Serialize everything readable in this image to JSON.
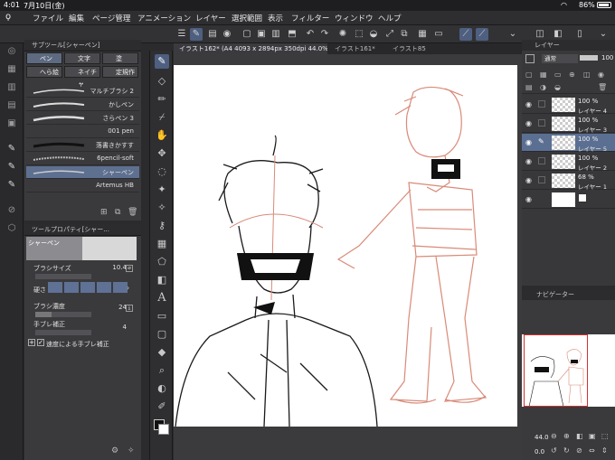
{
  "status_bar": {
    "time": "4:01",
    "date": "7月10日(金)",
    "battery": "86%"
  },
  "menu": [
    "ファイル",
    "編集",
    "ページ管理",
    "アニメーション",
    "レイヤー",
    "選択範囲",
    "表示",
    "フィルター",
    "ウィンドウ",
    "ヘルプ"
  ],
  "subtool_panel": {
    "title": "サブツール[シャーペン]",
    "tabs": [
      "ペン",
      "文字",
      "塗",
      "へら絵",
      "ネイチャ",
      "定規作"
    ],
    "brushes": [
      "マルチブラシ 2",
      "かしペン",
      "さらペン 3",
      "001 pen",
      "落書きかすす",
      "6pencil-soft",
      "シャーペン",
      "Artemus HB"
    ],
    "selected_brush": "シャーペン"
  },
  "tool_property": {
    "title": "ツールプロパティ[シャー...",
    "tool_name": "シャーペン",
    "brush_size_label": "ブラシサイズ",
    "brush_size_value": "10.4",
    "hardness_label": "硬さ",
    "density_label": "ブラシ濃度",
    "density_value": "24",
    "stabilization_label": "手ブレ補正",
    "stabilization_value": "4",
    "speed_stabilization_label": "速度による手ブレ補正"
  },
  "document_tabs": [
    "イラスト162* (A4 4093 x 2894px 350dpi 44.0%)",
    "イラスト161*",
    "イラスト85"
  ],
  "layer_panel": {
    "title": "レイヤー",
    "blend_mode": "通常",
    "opacity": "100",
    "layers": [
      {
        "opacity": "100 %",
        "name": "レイヤー 4",
        "selected": false
      },
      {
        "opacity": "100 %",
        "name": "レイヤー 3",
        "selected": false
      },
      {
        "opacity": "100 %",
        "name": "レイヤー 5",
        "selected": true
      },
      {
        "opacity": "100 %",
        "name": "レイヤー 2",
        "selected": false
      },
      {
        "opacity": "68 %",
        "name": "レイヤー 1",
        "selected": false
      },
      {
        "opacity": "",
        "name": "",
        "selected": false
      }
    ]
  },
  "navigator": {
    "title": "ナビゲーター",
    "zoom": "44.0",
    "rotation": "0.0"
  },
  "colors": {
    "accent": "#5b6f92",
    "sketch": "#d98a78",
    "ink": "#1a1a1a"
  }
}
